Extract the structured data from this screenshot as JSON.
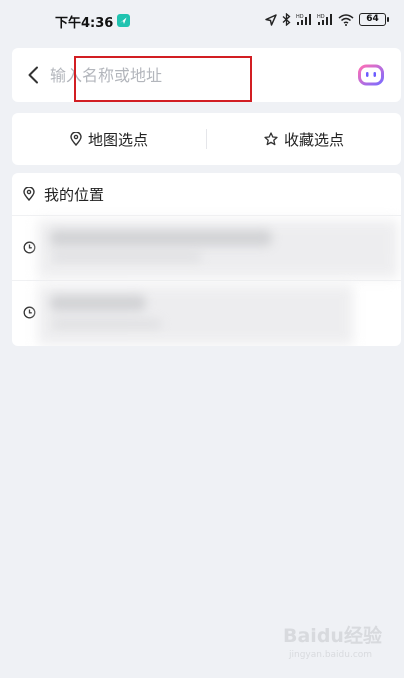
{
  "status_bar": {
    "time": "下午4:36",
    "battery": "64",
    "icons": [
      "location-arrow-icon",
      "bluetooth-icon",
      "signal-hd-icon",
      "signal-hd-icon",
      "wifi-icon",
      "battery-icon"
    ]
  },
  "search": {
    "placeholder": "输入名称或地址",
    "value": "",
    "back_icon": "chevron-left-icon",
    "assistant_icon": "assistant-robot-icon"
  },
  "actions": {
    "map_pick_label": "地图选点",
    "map_pick_icon": "map-pin-icon",
    "favorite_pick_label": "收藏选点",
    "favorite_pick_icon": "star-icon"
  },
  "locations": {
    "my_location_label": "我的位置",
    "my_location_icon": "map-pin-icon",
    "history_icon": "clock-icon"
  },
  "colors": {
    "background": "#eff1f5",
    "card": "#ffffff",
    "highlight_border": "#d21e23",
    "assistant_gradient": [
      "#ff6fb5",
      "#7b6bff"
    ]
  },
  "watermark": {
    "main": "Baidu经验",
    "sub": "jingyan.baidu.com"
  }
}
